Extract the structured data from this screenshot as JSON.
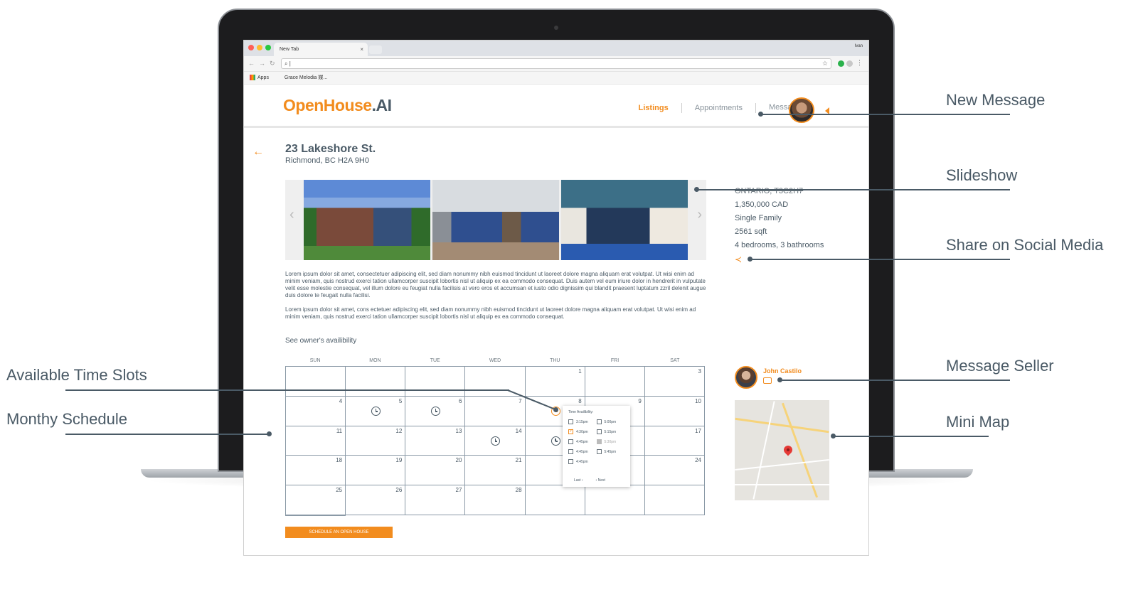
{
  "browser": {
    "tab_title": "New Tab",
    "tab_close": "×",
    "user": "Ivan",
    "address": "|",
    "bookmarks": [
      "Apps",
      "Grace Melodia 媒..."
    ]
  },
  "app": {
    "logo_main": "OpenHouse",
    "logo_ai": ".AI",
    "nav": [
      {
        "label": "Listings"
      },
      {
        "label": "Appointments"
      },
      {
        "label": "Messages"
      }
    ],
    "new_message_badge": "*"
  },
  "listing": {
    "street": "23 Lakeshore St.",
    "city": "Richmond, BC H2A 9H0",
    "region": "ONTARIO, T3C2H7",
    "price": "1,350,000 CAD",
    "type": "Single Family",
    "area": "2561 sqft",
    "rooms": "4 bedrooms, 3 bathrooms",
    "description_1": "Lorem ipsum dolor sit amet, consectetuer adipiscing elit, sed diam nonummy nibh euismod tincidunt ut laoreet dolore magna aliquam erat volutpat. Ut wisi enim ad minim veniam, quis nostrud exerci tation ullamcorper suscipit lobortis nisl ut aliquip ex ea commodo consequat. Duis autem vel eum iriure dolor in hendrerit in vulputate velit esse molestie consequat, vel illum dolore eu feugiat nulla facilisis at vero eros et accumsan et iusto odio dignissim qui blandit praesent luptatum zzril delenit augue duis dolore te feugait nulla facilisi.",
    "description_2": "Lorem ipsum dolor sit amet, cons ectetuer adipiscing elit, sed diam nonummy nibh euismod tincidunt ut laoreet dolore magna aliquam erat volutpat. Ut wisi enim ad minim veniam, quis nostrud exerci tation ullamcorper suscipit lobortis nisl ut aliquip ex ea commodo consequat.",
    "availability_label": "See owner's availibility"
  },
  "calendar": {
    "weekdays": [
      "SUN",
      "MON",
      "TUE",
      "WED",
      "THU",
      "FRI",
      "SAT"
    ],
    "cells": [
      "",
      "",
      "",
      "",
      "1",
      "",
      "3",
      "4",
      "5",
      "6",
      "7",
      "8",
      "9",
      "10",
      "11",
      "12",
      "13",
      "14",
      "15",
      "",
      "17",
      "18",
      "19",
      "20",
      "21",
      "22",
      "",
      "24",
      "25",
      "26",
      "27",
      "28",
      "",
      "",
      "",
      ""
    ],
    "time_popup": {
      "title": "Time Availibility:",
      "slots": [
        {
          "time": "3:15pm",
          "state": "open"
        },
        {
          "time": "5:00pm",
          "state": "open"
        },
        {
          "time": "4:30pm",
          "state": "checked"
        },
        {
          "time": "5:15pm",
          "state": "open"
        },
        {
          "time": "4:45pm",
          "state": "open"
        },
        {
          "time": "5:30pm",
          "state": "disabled"
        },
        {
          "time": "4:45pm",
          "state": "open"
        },
        {
          "time": "5:45pm",
          "state": "open"
        },
        {
          "time": "4:45pm",
          "state": "open"
        }
      ],
      "prev": "Last",
      "next": "Next"
    },
    "schedule_button": "SCHEDULE AN OPEN HOUSE"
  },
  "seller": {
    "name": "John Castilo"
  },
  "callouts": {
    "new_message": "New Message",
    "slideshow": "Slideshow",
    "share": "Share on Social Media",
    "message_seller": "Message Seller",
    "mini_map": "Mini Map",
    "time_slots": "Available Time Slots",
    "monthly": "Monthy Schedule"
  },
  "colors": {
    "accent": "#f28c1e",
    "text": "#4a5a66"
  }
}
